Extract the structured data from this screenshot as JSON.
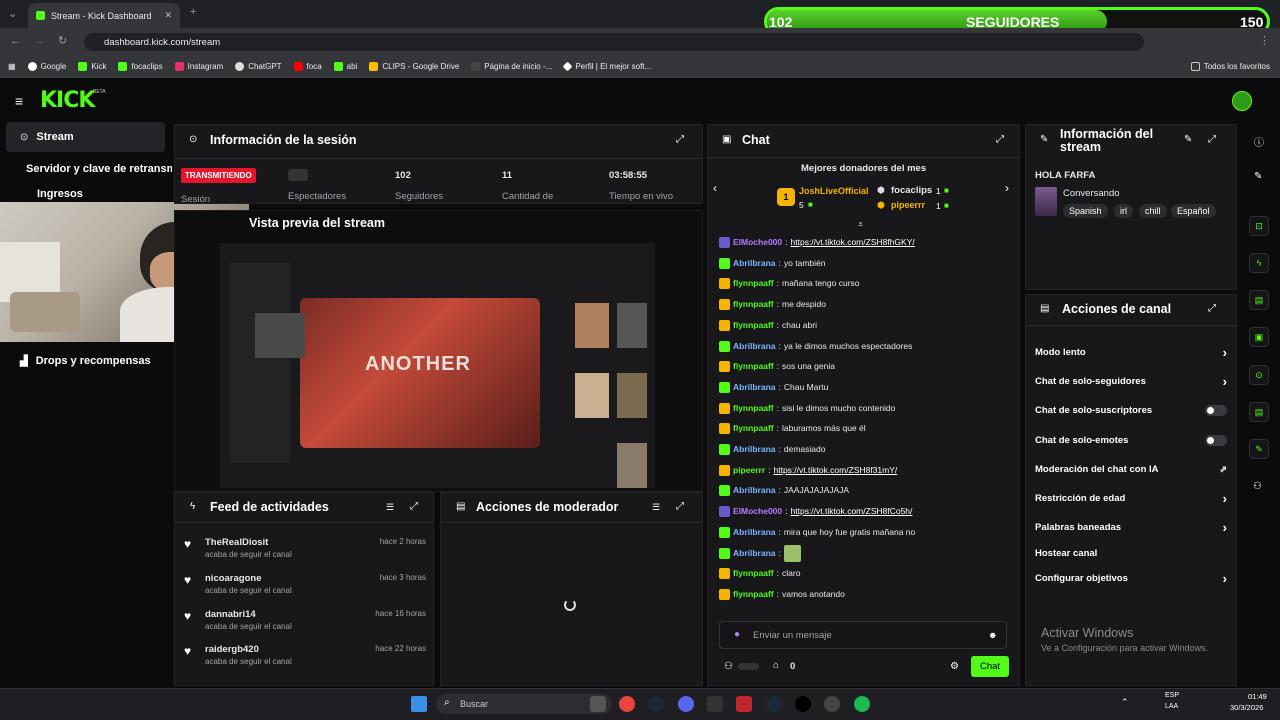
{
  "browser": {
    "tab_title": "Stream - Kick Dashboard",
    "url": "dashboard.kick.com/stream",
    "bookmarks": [
      "Google",
      "Kick",
      "focaclips",
      "Instagram",
      "ChatGPT",
      "foca",
      "abi",
      "CLIPS - Google Drive",
      "Página de inicio -...",
      "Perfil | El mejor soft..."
    ],
    "all_bookmarks": "Todos los favoritos"
  },
  "overlay": {
    "followers_current": "102",
    "followers_label": "SEGUIDORES",
    "followers_goal": "150",
    "followers_progress": 0.68
  },
  "brand": {
    "logo": "KICK",
    "beta": "BETA"
  },
  "sidebar": {
    "items": [
      {
        "label": "Stream"
      },
      {
        "label": "Servidor y clave de retransmisión"
      },
      {
        "label": "Ingresos"
      },
      {
        "label": "Drops y recompensas"
      }
    ]
  },
  "session": {
    "title": "Información de la sesión",
    "status_badge": "TRANSMITIENDO",
    "status_sub": "Sesión",
    "stats": [
      {
        "value": "",
        "label": "Espectadores"
      },
      {
        "value": "102",
        "label": "Seguidores"
      },
      {
        "value": "11",
        "label": "Cantidad de"
      },
      {
        "value": "03:58:55",
        "label": "Tiempo en vivo"
      }
    ]
  },
  "preview": {
    "title": "Vista previa del stream",
    "overlay_text": "ANOTHER"
  },
  "feed": {
    "title": "Feed de actividades",
    "items": [
      {
        "user": "TheRealDiosit",
        "action": "acaba de seguir el canal",
        "time": "hace 2 horas"
      },
      {
        "user": "nicoaragone",
        "action": "acaba de seguir el canal",
        "time": "hace 3 horas"
      },
      {
        "user": "dannabri14",
        "action": "acaba de seguir el canal",
        "time": "hace 16 horas"
      },
      {
        "user": "raidergb420",
        "action": "acaba de seguir el canal",
        "time": "hace 22 horas"
      }
    ]
  },
  "mod_actions": {
    "title": "Acciones de moderador"
  },
  "chat": {
    "title": "Chat",
    "donors_title": "Mejores donadores del mes",
    "donors": [
      {
        "rank": "1",
        "name": "JoshLiveOfficial",
        "amount": "5"
      },
      {
        "name": "focaclips",
        "amount": "1"
      },
      {
        "name": "pipeerrr",
        "amount": "1"
      }
    ],
    "messages": [
      {
        "user": "ElMoche000",
        "color": "#b57cff",
        "text": "https://vt.tiktok.com/ZSH8fhGKY/",
        "link": true
      },
      {
        "user": "Abrilbrana",
        "color": "#7ab6ff",
        "text": "yo también"
      },
      {
        "user": "flynnpaaff",
        "color": "#53fc18",
        "text": "mañana tengo curso"
      },
      {
        "user": "flynnpaaff",
        "color": "#53fc18",
        "text": "me despido"
      },
      {
        "user": "flynnpaaff",
        "color": "#53fc18",
        "text": "chau abri"
      },
      {
        "user": "Abrilbrana",
        "color": "#7ab6ff",
        "text": "ya le dimos muchos espectadores"
      },
      {
        "user": "flynnpaaff",
        "color": "#53fc18",
        "text": "sos una genia"
      },
      {
        "user": "Abrilbrana",
        "color": "#7ab6ff",
        "text": "Chau Martu"
      },
      {
        "user": "flynnpaaff",
        "color": "#53fc18",
        "text": "sisi le dimos mucho contenido"
      },
      {
        "user": "flynnpaaff",
        "color": "#53fc18",
        "text": "laburamos más que él"
      },
      {
        "user": "Abrilbrana",
        "color": "#7ab6ff",
        "text": "demasiado"
      },
      {
        "user": "pipeerrr",
        "color": "#53fc18",
        "text": "https://vt.tiktok.com/ZSH8f31mY/",
        "link": true
      },
      {
        "user": "Abrilbrana",
        "color": "#7ab6ff",
        "text": "JAAJAJAJAJAJA"
      },
      {
        "user": "ElMoche000",
        "color": "#b57cff",
        "text": "https://vt.tiktok.com/ZSH8fCo5h/",
        "link": true
      },
      {
        "user": "Abrilbrana",
        "color": "#7ab6ff",
        "text": "mira que hoy fue gratis mañana no"
      },
      {
        "user": "Abrilbrana",
        "color": "#7ab6ff",
        "text": ""
      },
      {
        "user": "flynnpaaff",
        "color": "#53fc18",
        "text": "claro"
      },
      {
        "user": "flynnpaaff",
        "color": "#53fc18",
        "text": "vamos anotando"
      }
    ],
    "input_placeholder": "Enviar un mensaje",
    "viewer_count": "0",
    "send_label": "Chat"
  },
  "stream_info": {
    "title": "Información del stream",
    "stream_title": "HOLA FARFA",
    "category": "Conversando",
    "tags": [
      "Spanish",
      "irl",
      "chill",
      "Español"
    ]
  },
  "channel_actions": {
    "title": "Acciones de canal",
    "items": [
      {
        "label": "Modo lento",
        "control": "arrow"
      },
      {
        "label": "Chat de solo-seguidores",
        "control": "arrow"
      },
      {
        "label": "Chat de solo-suscriptores",
        "control": "toggle"
      },
      {
        "label": "Chat de solo-emotes",
        "control": "toggle"
      },
      {
        "label": "Moderación del chat con IA",
        "control": "external"
      },
      {
        "label": "Restricción de edad",
        "control": "arrow"
      },
      {
        "label": "Palabras baneadas",
        "control": "arrow"
      },
      {
        "label": "Hostear canal",
        "control": "none"
      },
      {
        "label": "Configurar objetivos",
        "control": "arrow"
      }
    ]
  },
  "windows": {
    "activate_title": "Activar Windows",
    "activate_sub": "Ve a Configuración para activar Windows.",
    "search_placeholder": "Buscar",
    "lang": "ESP",
    "lang_sub": "LAA",
    "time": "01:49",
    "date": "30/3/2026"
  }
}
